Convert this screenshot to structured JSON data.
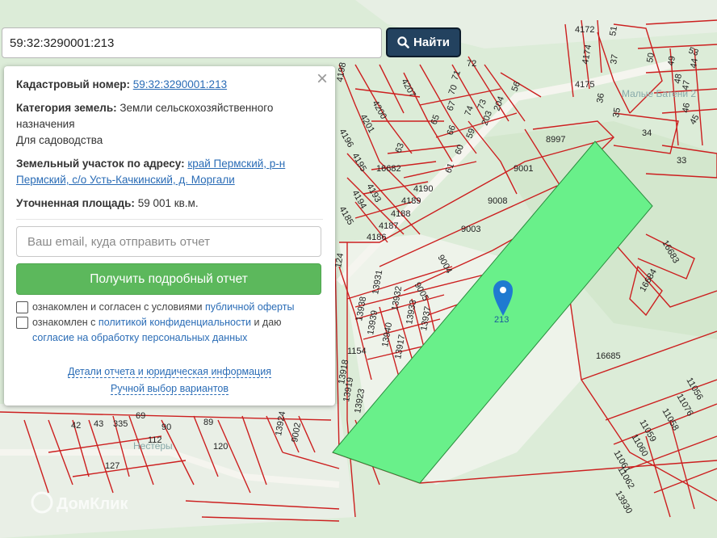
{
  "search": {
    "value": "59:32:3290001:213",
    "button_label": "Найти"
  },
  "info": {
    "cad_label": "Кадастровый номер:",
    "cad_value": "59:32:3290001:213",
    "cat_label": "Категория земель:",
    "cat_value": "Земли сельскохозяйственного назначения",
    "use_value": "Для садоводства",
    "addr_label": "Земельный участок по адресу:",
    "addr_value": "край Пермский, р-н Пермский, с/о Усть-Качкинский, д. Моргали",
    "area_label": "Уточненная площадь:",
    "area_value": "59 001 кв.м."
  },
  "form": {
    "email_placeholder": "Ваш email, куда отправить отчет",
    "submit_label": "Получить подробный отчет",
    "check1_text": "ознакомлен и согласен с условиями",
    "check1_link": "публичной оферты",
    "check2_text": "ознакомлен с",
    "check2_link": "политикой конфиденциальности",
    "check2_mid": "и даю",
    "check2_link2": "согласие на обработку персональных данных",
    "details_link": "Детали отчета и юридическая информация",
    "manual_link": "Ручной выбор вариантов"
  },
  "map": {
    "marker_label": "213",
    "place_names": [
      "Малые Батени 2",
      "Нестеры"
    ],
    "watermark": "ДомКлик",
    "parcel_labels": [
      "4172",
      "51",
      "53",
      "4174",
      "37",
      "50",
      "49",
      "44",
      "4175",
      "48",
      "47",
      "35",
      "46",
      "36",
      "34",
      "33",
      "45",
      "8997",
      "9001",
      "9008",
      "9003",
      "9004",
      "9005",
      "16682",
      "4190",
      "4189",
      "4188",
      "4187",
      "4186",
      "4185",
      "4194",
      "4193",
      "4195",
      "4196",
      "4198",
      "4201",
      "4200",
      "4207",
      "72",
      "71",
      "70",
      "67",
      "65",
      "63",
      "66",
      "60",
      "61",
      "59",
      "203",
      "204",
      "56",
      "74",
      "73",
      "16683",
      "16684",
      "16685",
      "11056",
      "11076",
      "11058",
      "11059",
      "11060",
      "11061",
      "11062",
      "13930",
      "13931",
      "13932",
      "13933",
      "13937",
      "13938",
      "13939",
      "13940",
      "13917",
      "13918",
      "13919",
      "13923",
      "13924",
      "9002",
      "1154",
      "124",
      "42",
      "43",
      "335",
      "90",
      "89",
      "120",
      "127",
      "112",
      "69"
    ],
    "colors": {
      "selected_fill": "#69f08a",
      "boundary": "#cc1f1f",
      "marker": "#1f7ad0"
    }
  }
}
